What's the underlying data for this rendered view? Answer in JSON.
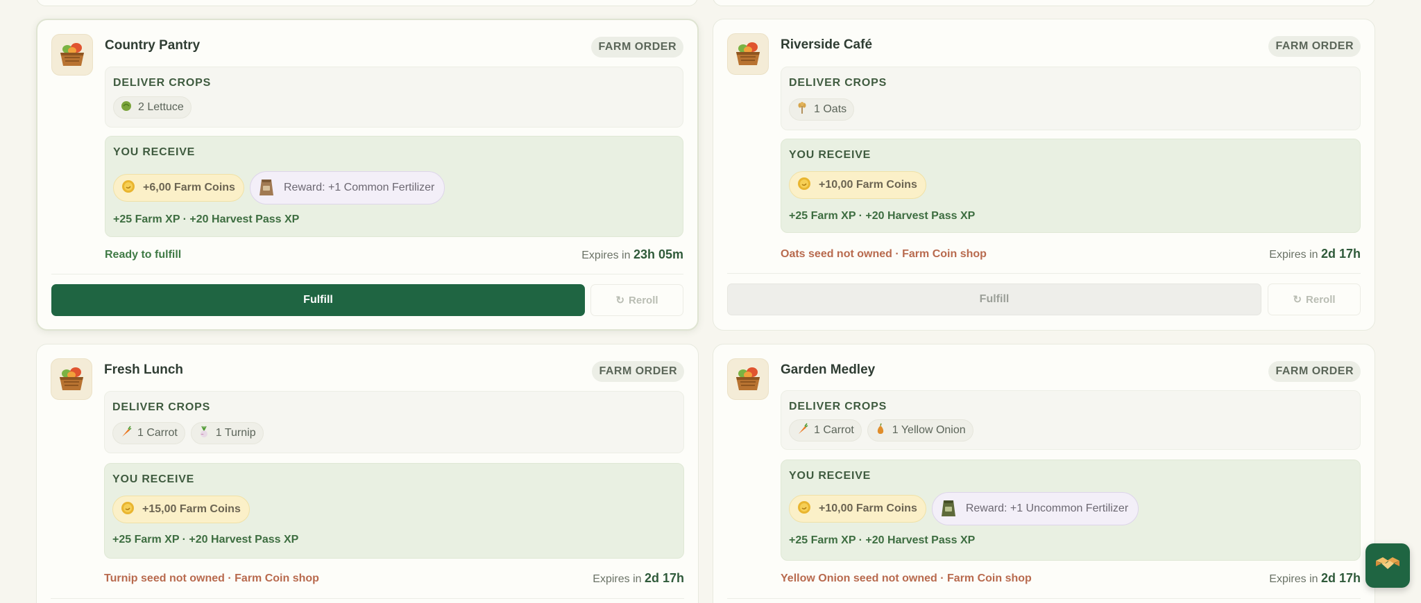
{
  "cards": [
    {
      "title": "Country Pantry",
      "badge": "FARM ORDER",
      "deliver_label": "DELIVER CROPS",
      "crops": [
        {
          "icon": "lettuce-icon",
          "label": "2 Lettuce"
        }
      ],
      "receive_label": "YOU RECEIVE",
      "coins": "+6,00 Farm Coins",
      "reward": "Reward: +1 Common Fertilizer",
      "xp": "+25 Farm XP · +20 Harvest Pass XP",
      "status": "Ready to fulfill",
      "expires_prefix": "Expires in",
      "expires_value": "23h 05m",
      "fulfill_label": "Fulfill",
      "reroll_label": "Reroll"
    },
    {
      "title": "Riverside Café",
      "badge": "FARM ORDER",
      "deliver_label": "DELIVER CROPS",
      "crops": [
        {
          "icon": "oats-icon",
          "label": "1 Oats"
        }
      ],
      "receive_label": "YOU RECEIVE",
      "coins": "+10,00 Farm Coins",
      "xp": "+25 Farm XP · +20 Harvest Pass XP",
      "status": "Oats seed not owned · Farm Coin shop",
      "expires_prefix": "Expires in",
      "expires_value": "2d 17h",
      "fulfill_label": "Fulfill",
      "reroll_label": "Reroll"
    },
    {
      "title": "Fresh Lunch",
      "badge": "FARM ORDER",
      "deliver_label": "DELIVER CROPS",
      "crops": [
        {
          "icon": "carrot-icon",
          "label": "1 Carrot"
        },
        {
          "icon": "turnip-icon",
          "label": "1 Turnip"
        }
      ],
      "receive_label": "YOU RECEIVE",
      "coins": "+15,00 Farm Coins",
      "xp": "+25 Farm XP · +20 Harvest Pass XP",
      "status": "Turnip seed not owned · Farm Coin shop",
      "expires_prefix": "Expires in",
      "expires_value": "2d 17h"
    },
    {
      "title": "Garden Medley",
      "badge": "FARM ORDER",
      "deliver_label": "DELIVER CROPS",
      "crops": [
        {
          "icon": "carrot-icon",
          "label": "1 Carrot"
        },
        {
          "icon": "onion-icon",
          "label": "1 Yellow Onion"
        }
      ],
      "receive_label": "YOU RECEIVE",
      "coins": "+10,00 Farm Coins",
      "reward": "Reward: +1 Uncommon Fertilizer",
      "xp": "+25 Farm XP · +20 Harvest Pass XP",
      "status": "Yellow Onion seed not owned · Farm Coin shop",
      "expires_prefix": "Expires in",
      "expires_value": "2d 17h"
    }
  ],
  "colors": {
    "primary_green": "#1f6542",
    "warn_text": "#b86a4e",
    "ok_text": "#3f7a45",
    "receive_bg": "#e9f0e2",
    "coin_chip_bg": "#fbf0c8"
  }
}
